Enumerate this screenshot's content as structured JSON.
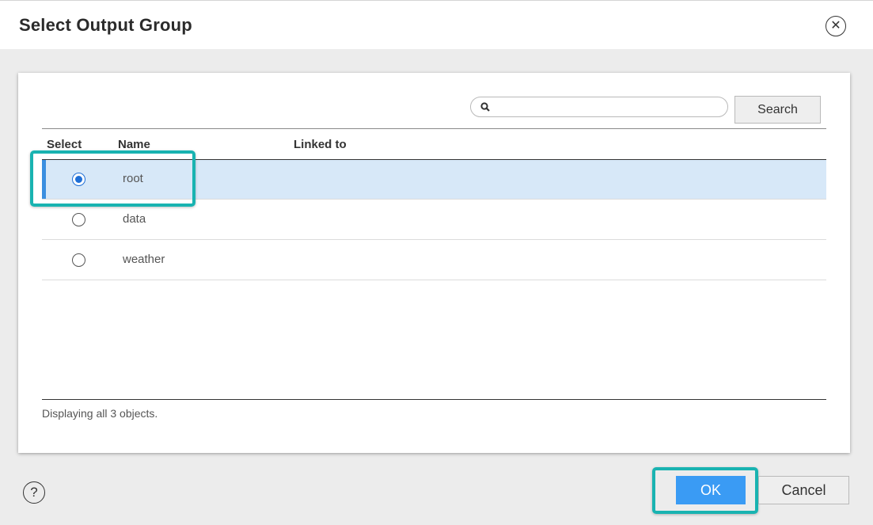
{
  "dialog": {
    "title": "Select Output Group",
    "close_icon": "close-icon"
  },
  "search": {
    "placeholder": "",
    "value": "",
    "button_label": "Search"
  },
  "table": {
    "columns": [
      "Select",
      "Name",
      "Linked to"
    ],
    "rows": [
      {
        "name": "root",
        "linked_to": "",
        "selected": true
      },
      {
        "name": "data",
        "linked_to": "",
        "selected": false
      },
      {
        "name": "weather",
        "linked_to": "",
        "selected": false
      }
    ],
    "status": "Displaying all 3 objects."
  },
  "footer": {
    "help_icon": "help-icon",
    "help_glyph": "?",
    "ok_label": "OK",
    "cancel_label": "Cancel"
  },
  "colors": {
    "accent": "#3a9bf4",
    "selected_row": "#d7e8f8",
    "highlight": "#19b3b1"
  }
}
